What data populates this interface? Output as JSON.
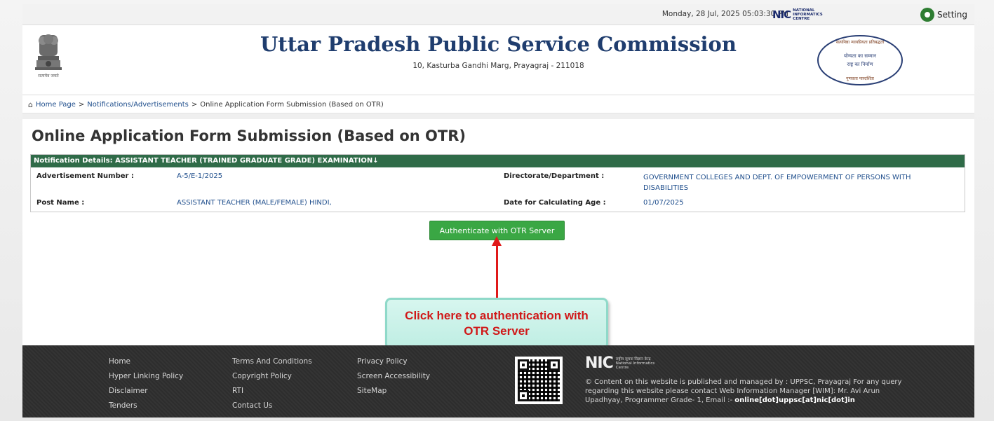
{
  "topbar": {
    "datetime": "Monday, 28 Jul, 2025 05:03:30 PM",
    "nic_logo_text": "NIC",
    "nic_logo_sub": "NATIONAL INFORMATICS CENTRE",
    "setting_label": "Setting"
  },
  "header": {
    "title": "Uttar Pradesh Public Service Commission",
    "address": "10, Kasturba Gandhi Marg, Prayagraj - 211018",
    "emblem_caption": "सत्यमेव जयते",
    "seal_lines": [
      "सत्यनिष्ठा न्यायप्रियता प्रतिबद्धता",
      "योग्यता का सम्मान",
      "राष्ट्र का निर्माण",
      "गुणवत्ता पारदर्शिता"
    ]
  },
  "breadcrumb": {
    "items": [
      "Home Page",
      "Notifications/Advertisements",
      "Online Application Form Submission (Based on OTR)"
    ],
    "separator": ">"
  },
  "page_title": "Online Application Form Submission (Based on OTR)",
  "notification": {
    "heading": "Notification Details: ASSISTANT TEACHER (TRAINED GRADUATE GRADE) EXAMINATION↓",
    "fields": [
      {
        "label": "Advertisement Number :",
        "value": "A-5/E-1/2025"
      },
      {
        "label": "Directorate/Department :",
        "value": "GOVERNMENT COLLEGES AND DEPT. OF EMPOWERMENT OF PERSONS WITH DISABILITIES"
      },
      {
        "label": "Post Name :",
        "value": "ASSISTANT TEACHER (MALE/FEMALE) HINDI,"
      },
      {
        "label": "Date for Calculating Age :",
        "value": "01/07/2025"
      }
    ]
  },
  "auth_button_label": "Authenticate with OTR Server",
  "callout_text": "Click here to authentication with OTR Server",
  "footer": {
    "col1": [
      "Home",
      "Hyper Linking Policy",
      "Disclaimer",
      "Tenders"
    ],
    "col2": [
      "Terms And Conditions",
      "Copyright Policy",
      "RTI",
      "Contact Us"
    ],
    "col3": [
      "Privacy Policy",
      "Screen Accessibility",
      "SiteMap"
    ],
    "nic_logo_text": "NIC",
    "nic_logo_sub": "राष्ट्रीय सूचना विज्ञान केन्द्र National Informatics Centre",
    "copyright_text": "© Content on this website is published and managed by : UPPSC, Prayagraj For any query regarding this website please contact Web Information Manager [WIM]: Mr. Avi Arun Upadhyay, Programmer Grade- 1, Email :-",
    "email": "online[dot]uppsc[at]nic[dot]in"
  },
  "colors": {
    "panel_header": "#2f6b48",
    "button": "#3aa744",
    "title": "#1f3d6e",
    "link": "#1f4e8c",
    "callout_text": "#d01919",
    "arrow": "#e01919",
    "footer_bg": "#2d2d2d"
  }
}
